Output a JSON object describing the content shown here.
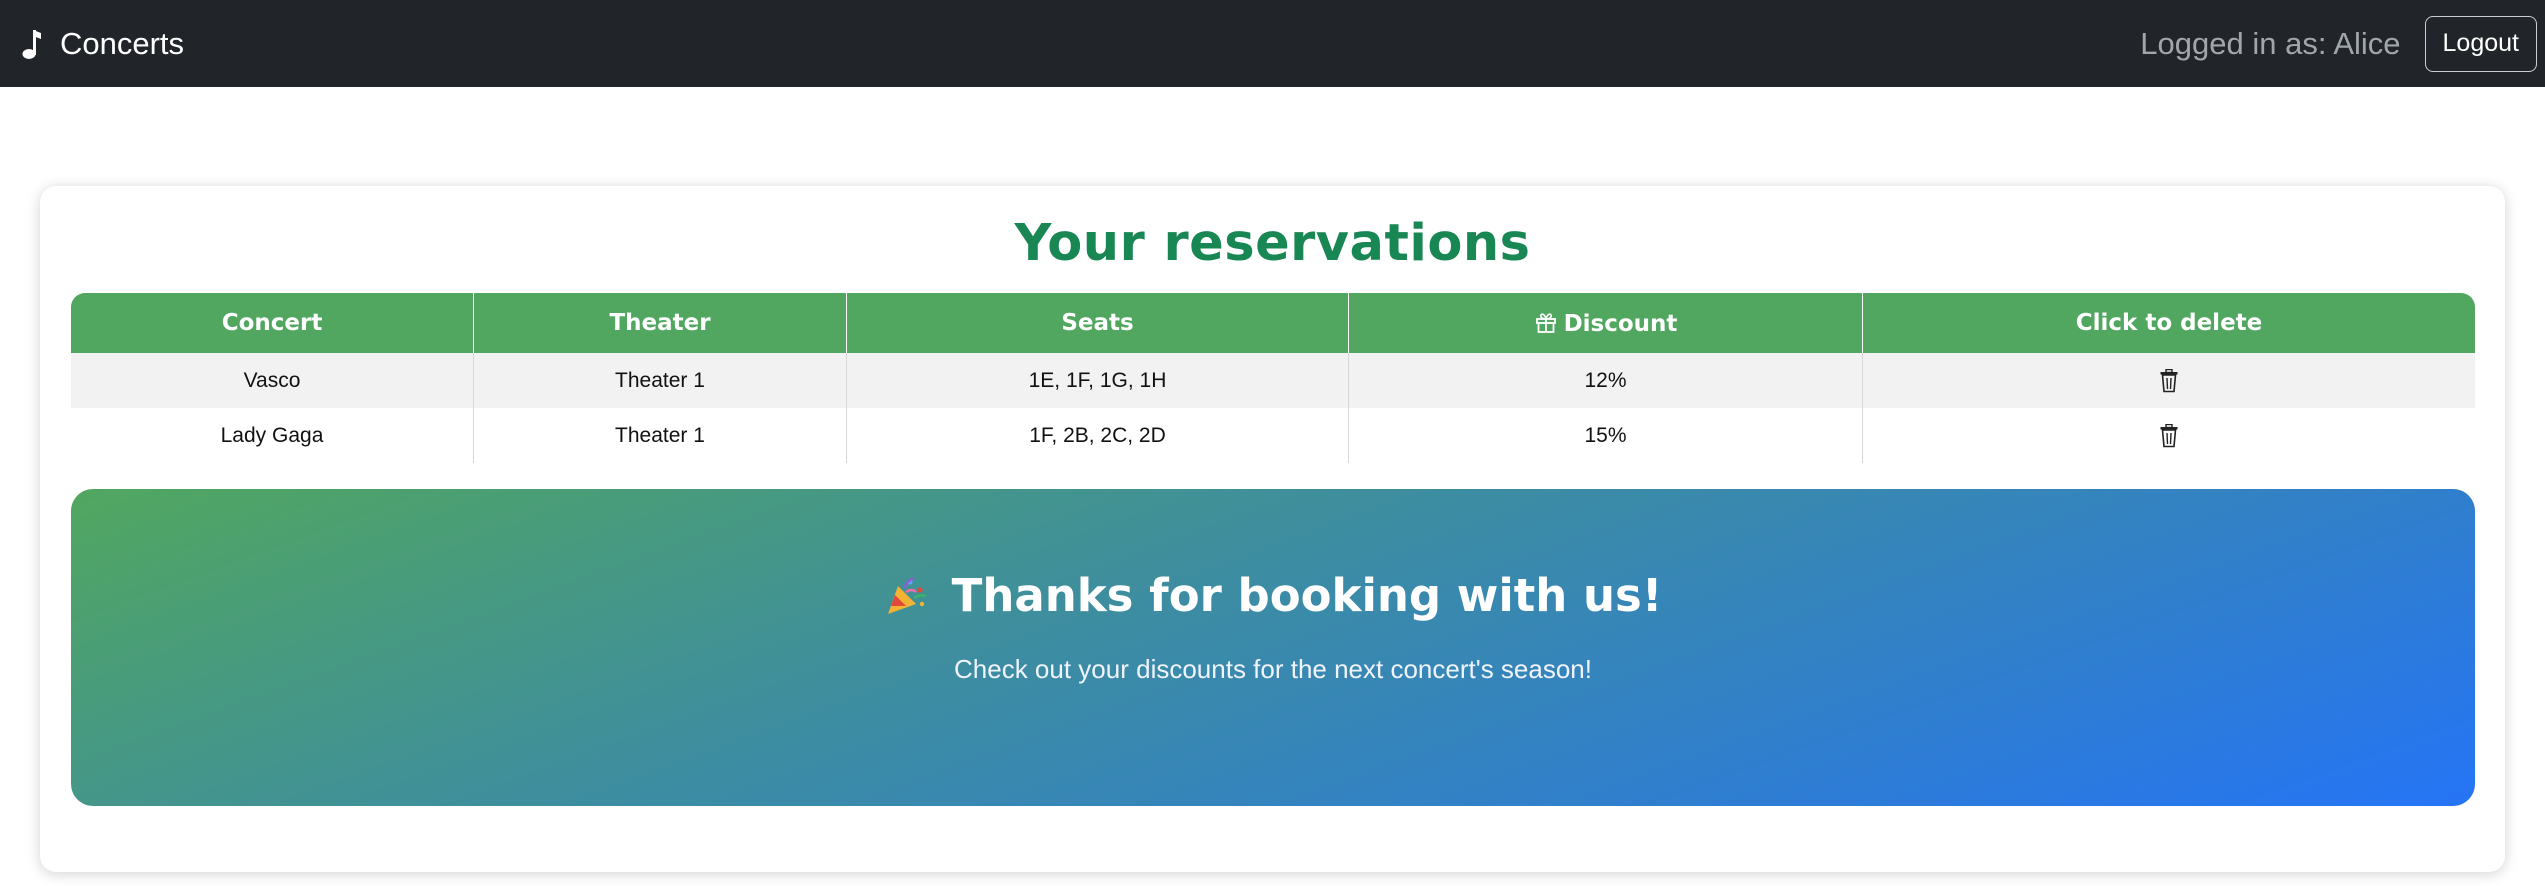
{
  "navbar": {
    "brand": "Concerts",
    "brand_icon": "music-note-icon",
    "logged_in_text": "Logged in as: Alice",
    "logout_label": "Logout"
  },
  "reservations": {
    "title": "Your reservations",
    "columns": {
      "concert": "Concert",
      "theater": "Theater",
      "seats": "Seats",
      "discount": "Discount",
      "delete": "Click to delete"
    },
    "rows": [
      {
        "concert": "Vasco",
        "theater": "Theater 1",
        "seats": "1E, 1F, 1G, 1H",
        "discount": "12%"
      },
      {
        "concert": "Lady Gaga",
        "theater": "Theater 1",
        "seats": "1F, 2B, 2C, 2D",
        "discount": "15%"
      }
    ]
  },
  "banner": {
    "title": "Thanks for booking with us!",
    "subtitle": "Check out your discounts for the next concert's season!",
    "icon": "party-popper-icon"
  },
  "colors": {
    "navbar_bg": "#212529",
    "title_green": "#198754",
    "header_green": "#51a75f",
    "banner_start": "#51a75f",
    "banner_end": "#2574f6"
  }
}
